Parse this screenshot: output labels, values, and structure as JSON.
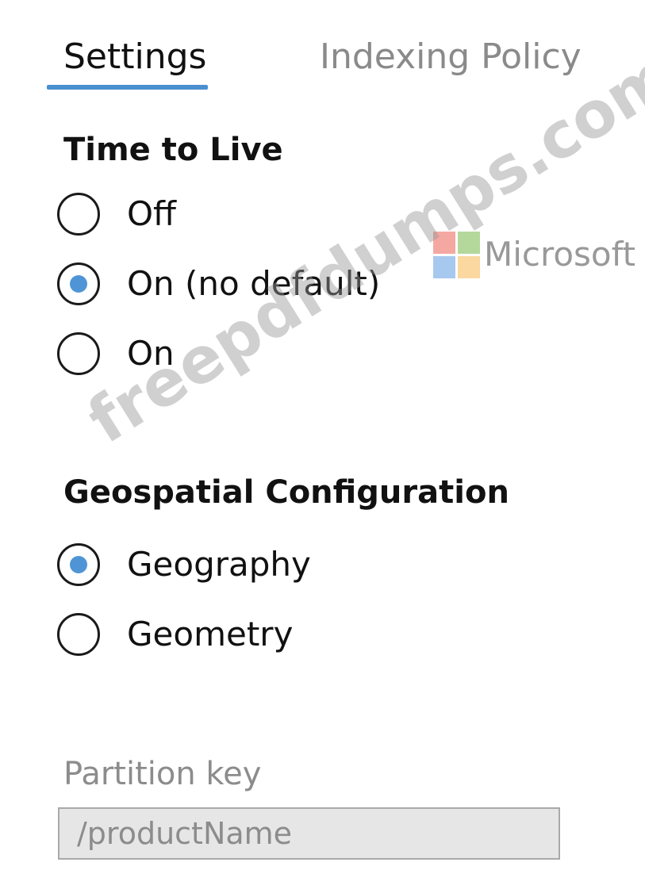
{
  "tabs": {
    "settings": "Settings",
    "indexing_policy": "Indexing Policy"
  },
  "time_to_live": {
    "heading": "Time to Live",
    "options": [
      {
        "label": "Off",
        "selected": false
      },
      {
        "label": "On (no default)",
        "selected": true
      },
      {
        "label": "On",
        "selected": false
      }
    ]
  },
  "geospatial": {
    "heading": "Geospatial Configuration",
    "options": [
      {
        "label": "Geography",
        "selected": true
      },
      {
        "label": "Geometry",
        "selected": false
      }
    ]
  },
  "partition_key": {
    "label": "Partition key",
    "value": "/productName"
  },
  "watermark": {
    "logo_text": "Microsoft",
    "site_text": "freepdfdumps.com"
  },
  "colors": {
    "accent": "#4f95d6",
    "tab_underline": "#4a8fd0",
    "input_bg": "#e6e6e6"
  }
}
